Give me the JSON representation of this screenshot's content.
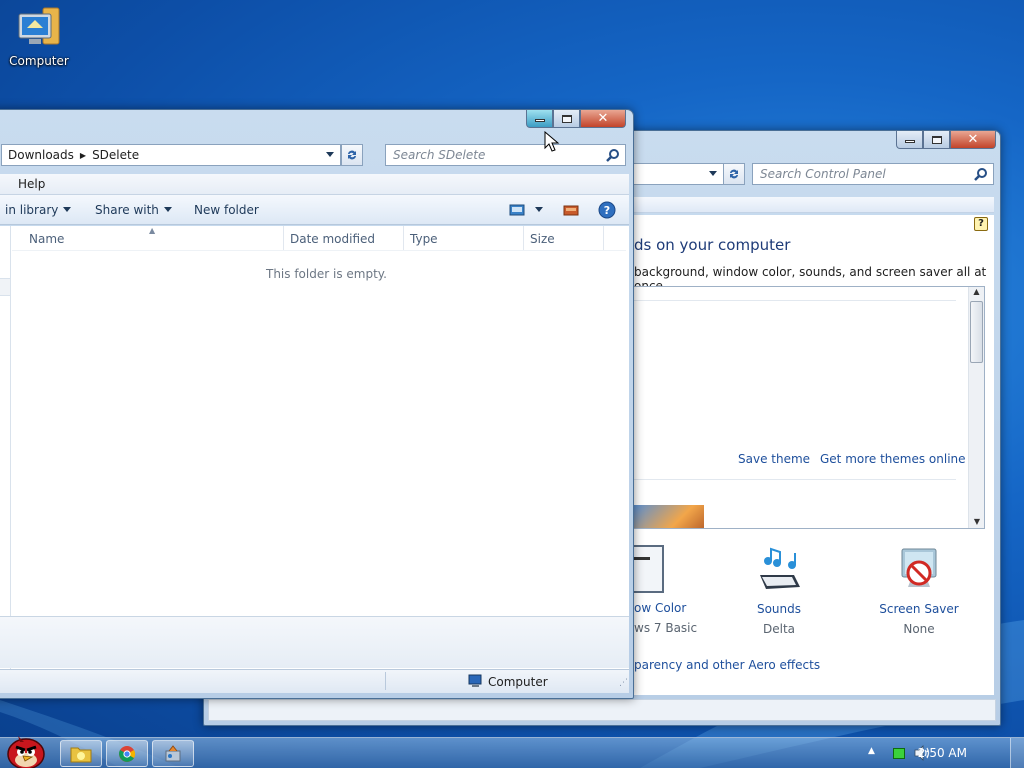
{
  "desktop": {
    "icon_computer_label": "Computer"
  },
  "control_panel": {
    "search_placeholder": "Search Control Panel",
    "heading": "ds on your computer",
    "description": "background, window color, sounds, and screen saver all at once.",
    "save_theme": "Save theme",
    "get_more_themes": "Get more themes online",
    "window_color_label": "ow Color",
    "window_color_value": "ws 7 Basic",
    "sounds_label": "Sounds",
    "sounds_value": "Delta",
    "screen_saver_label": "Screen Saver",
    "screen_saver_value": "None",
    "aero_link": "parency and other Aero effects"
  },
  "explorer": {
    "breadcrumb": [
      "Downloads",
      "SDelete"
    ],
    "search_placeholder": "Search SDelete",
    "menu_help": "Help",
    "cmd_include_library": "in library",
    "cmd_share_with": "Share with",
    "cmd_new_folder": "New folder",
    "columns": [
      "Name",
      "Date modified",
      "Type",
      "Size"
    ],
    "empty_message": "This folder is empty.",
    "status_location": "Computer"
  },
  "taskbar": {
    "clock": "2:50 AM",
    "apps": [
      "Angry Birds Space",
      "Windows Explorer",
      "Google Chrome",
      "Control Panel"
    ]
  },
  "colors": {
    "link": "#1e4f9c",
    "close_button": "#c2442a",
    "desktop_blue": "#1566c6"
  }
}
